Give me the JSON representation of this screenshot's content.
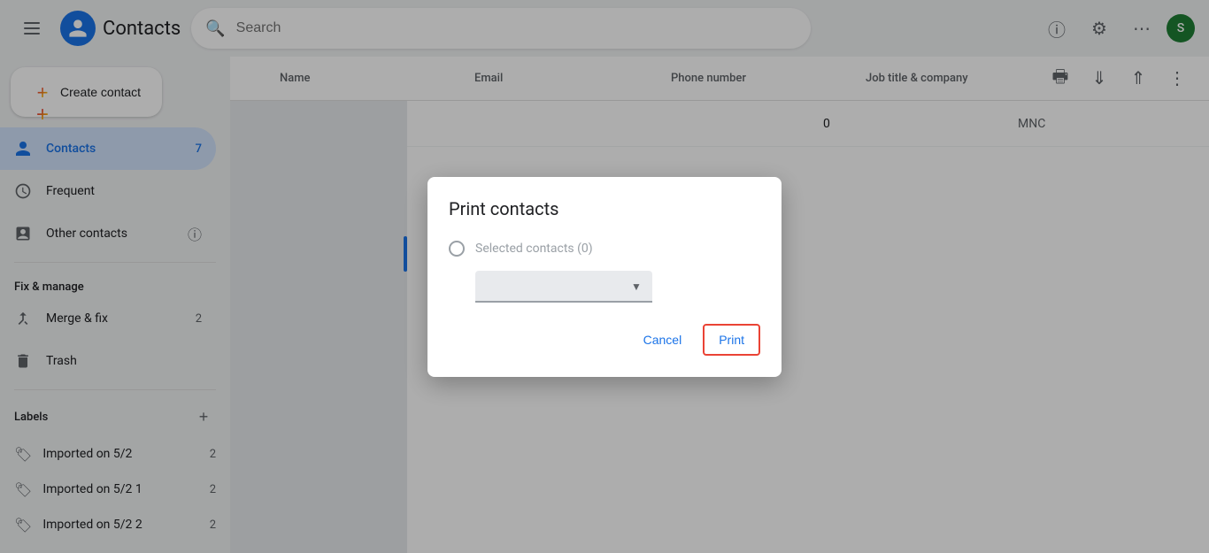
{
  "topbar": {
    "app_name": "Contacts",
    "search_placeholder": "Search"
  },
  "sidebar": {
    "create_btn": "Create contact",
    "items": [
      {
        "id": "contacts",
        "label": "Contacts",
        "count": "7",
        "active": true
      },
      {
        "id": "frequent",
        "label": "Frequent",
        "count": ""
      },
      {
        "id": "other-contacts",
        "label": "Other contacts",
        "count": ""
      }
    ],
    "fix_manage_section": "Fix & manage",
    "fix_items": [
      {
        "id": "merge-fix",
        "label": "Merge & fix",
        "count": "2"
      },
      {
        "id": "trash",
        "label": "Trash",
        "count": ""
      }
    ],
    "labels_section": "Labels",
    "labels": [
      {
        "id": "imported-1",
        "label": "Imported on 5/2",
        "count": "2"
      },
      {
        "id": "imported-2",
        "label": "Imported on 5/2 1",
        "count": "2"
      },
      {
        "id": "imported-3",
        "label": "Imported on 5/2 2",
        "count": "2"
      }
    ]
  },
  "table": {
    "col_name": "Name",
    "col_email": "Email",
    "col_phone": "Phone number",
    "col_job": "Job title & company",
    "row": {
      "phone": "0",
      "job": "MNC"
    }
  },
  "modal": {
    "title": "Print contacts",
    "option_label": "Selected contacts (0)",
    "cancel_label": "Cancel",
    "print_label": "Print"
  },
  "user": {
    "initial": "S"
  }
}
